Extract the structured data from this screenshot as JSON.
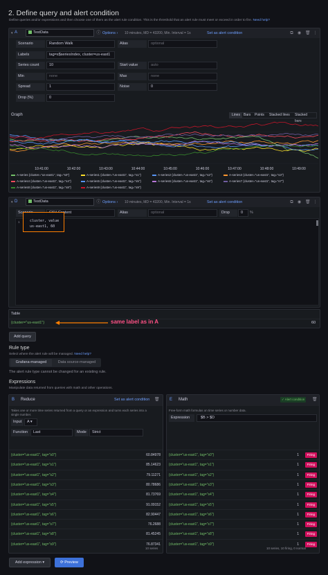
{
  "page": {
    "section_title": "2. Define query and alert condition",
    "section_desc": "Define queries and/or expressions and then choose one of them as the alert rule condition. This is the threshold that an alert rule must meet or exceed in order to fire.",
    "need_help": "Need help?"
  },
  "queryA": {
    "ref": "A",
    "datasource": "TestData",
    "options_label": "Options",
    "options_summary": "10 minutes, MD = 43200, Min. Interval = 1s",
    "set_alert": "Set as alert condition",
    "fields": {
      "scenario_label": "Scenario",
      "scenario_value": "Random Walk",
      "alias_label": "Alias",
      "alias_placeholder": "optional",
      "labels_label": "Labels",
      "labels_value": "tag=s$seriesIndex, cluster=us-east1",
      "series_count_label": "Series count",
      "series_count_value": "10",
      "start_value_label": "Start value",
      "start_value_placeholder": "auto",
      "min_label": "Min",
      "min_placeholder": "none",
      "max_label": "Max",
      "max_placeholder": "none",
      "spread_label": "Spread",
      "spread_value": "1",
      "noise_label": "Noise",
      "noise_value": "0",
      "drop_label": "Drop (%)",
      "drop_value": "0"
    },
    "graph_title": "Graph",
    "graph_tabs": [
      "Lines",
      "Bars",
      "Points",
      "Stacked lines",
      "Stacked bars"
    ],
    "time_ticks": [
      "10:41:00",
      "10:42:00",
      "10:43:00",
      "10:44:00",
      "10:45:00",
      "10:46:00",
      "10:47:00",
      "10:48:00",
      "10:49:00",
      "10:50:0"
    ],
    "legend": [
      {
        "label": "A-series {cluster=\"us-east1\", tag=\"s0\"}",
        "color": "#73bf69"
      },
      {
        "label": "A-series1 {cluster=\"us-east1\", tag=\"s1\"}",
        "color": "#fade2a"
      },
      {
        "label": "A-series2 {cluster=\"us-east1\", tag=\"s2\"}",
        "color": "#5794f2"
      },
      {
        "label": "A-series3 {cluster=\"us-east1\", tag=\"s3\"}",
        "color": "#ff9830"
      },
      {
        "label": "A-series4 {cluster=\"us-east1\", tag=\"s4\"}",
        "color": "#f2495c"
      },
      {
        "label": "A-series5 {cluster=\"us-east1\", tag=\"s5\"}",
        "color": "#5794f2"
      },
      {
        "label": "A-series6 {cluster=\"us-east1\", tag=\"s6\"}",
        "color": "#b877d9"
      },
      {
        "label": "A-series7 {cluster=\"us-east1\", tag=\"s7\"}",
        "color": "#705da0"
      },
      {
        "label": "A-series8 {cluster=\"us-east1\", tag=\"s8\"}",
        "color": "#37872d"
      },
      {
        "label": "A-series9 {cluster=\"us-east1\", tag=\"s9\"}",
        "color": "#c4162a"
      }
    ]
  },
  "queryD": {
    "ref": "D",
    "datasource": "TestData",
    "options_label": "Options",
    "options_summary": "10 minutes, MD = 43200, Min. Interval = 1s",
    "set_alert": "Set as alert condition",
    "scenario_label": "Scenario",
    "scenario_value": "CSV Content",
    "alias_label": "Alias",
    "alias_placeholder": "optional",
    "drop_label": "Drop",
    "drop_value": "0",
    "percent": "%",
    "csv_line1": "cluster, value",
    "csv_line2": "us-east1, 60",
    "table_title": "Table",
    "table_row_label": "{cluster=\"us-east1\"}",
    "table_row_value": "60",
    "annotation": "same label as in A"
  },
  "add_query": "Add query",
  "rule_type": {
    "title": "Rule type",
    "desc": "Select where the alert rule will be managed.",
    "need_help": "Need help?",
    "options": [
      "Grafana-managed",
      "Data source-managed"
    ],
    "note": "The alert rule type cannot be changed for an existing rule."
  },
  "expressions": {
    "title": "Expressions",
    "desc": "Manipulate data returned from queries with math and other operations.",
    "reduce": {
      "ref": "B",
      "title": "Reduce",
      "set_alert": "Set as alert condition",
      "desc": "Takes one or more time series returned from a query or an expression and turns each series into a single number.",
      "input_label": "Input",
      "input_value": "A",
      "function_label": "Function",
      "function_value": "Last",
      "mode_label": "Mode",
      "mode_value": "Strict",
      "rows": [
        {
          "label": "{cluster=\"us-east1\", tag=\"s0\"}",
          "value": "60.84978"
        },
        {
          "label": "{cluster=\"us-east1\", tag=\"s1\"}",
          "value": "85.14623"
        },
        {
          "label": "{cluster=\"us-east1\", tag=\"s2\"}",
          "value": "79.11271"
        },
        {
          "label": "{cluster=\"us-east1\", tag=\"s3\"}",
          "value": "80.78686"
        },
        {
          "label": "{cluster=\"us-east1\", tag=\"s4\"}",
          "value": "81.73769"
        },
        {
          "label": "{cluster=\"us-east1\", tag=\"s5\"}",
          "value": "91.09152"
        },
        {
          "label": "{cluster=\"us-east1\", tag=\"s6\"}",
          "value": "82.90447"
        },
        {
          "label": "{cluster=\"us-east1\", tag=\"s7\"}",
          "value": "76.2688"
        },
        {
          "label": "{cluster=\"us-east1\", tag=\"s8\"}",
          "value": "81.45245"
        },
        {
          "label": "{cluster=\"us-east1\", tag=\"s9\"}",
          "value": "76.87341"
        }
      ],
      "footer": "10 series"
    },
    "math": {
      "ref": "E",
      "title": "Math",
      "alert_badge": "✓ Alert condition",
      "desc": "Free-form math formulas on time series or number data.",
      "expression_label": "Expression",
      "expression_value": "$B > $D",
      "rows": [
        {
          "label": "{cluster=\"us-east1\", tag=\"s0\"}",
          "value": "1",
          "status": "Firing"
        },
        {
          "label": "{cluster=\"us-east1\", tag=\"s1\"}",
          "value": "1",
          "status": "Firing"
        },
        {
          "label": "{cluster=\"us-east1\", tag=\"s2\"}",
          "value": "1",
          "status": "Firing"
        },
        {
          "label": "{cluster=\"us-east1\", tag=\"s3\"}",
          "value": "1",
          "status": "Firing"
        },
        {
          "label": "{cluster=\"us-east1\", tag=\"s4\"}",
          "value": "1",
          "status": "Firing"
        },
        {
          "label": "{cluster=\"us-east1\", tag=\"s5\"}",
          "value": "1",
          "status": "Firing"
        },
        {
          "label": "{cluster=\"us-east1\", tag=\"s6\"}",
          "value": "1",
          "status": "Firing"
        },
        {
          "label": "{cluster=\"us-east1\", tag=\"s7\"}",
          "value": "1",
          "status": "Firing"
        },
        {
          "label": "{cluster=\"us-east1\", tag=\"s8\"}",
          "value": "1",
          "status": "Firing"
        },
        {
          "label": "{cluster=\"us-east1\", tag=\"s9\"}",
          "value": "1",
          "status": "Firing"
        }
      ],
      "footer": "10 series, 10 firing, 0 normal"
    }
  },
  "bottom": {
    "add_expression": "Add expression",
    "preview": "Preview"
  },
  "colors": {
    "accent": "#3d71d9",
    "firing": "#d10e5c",
    "annotation": "#ff7f00",
    "annotation_text": "#ff5286"
  }
}
